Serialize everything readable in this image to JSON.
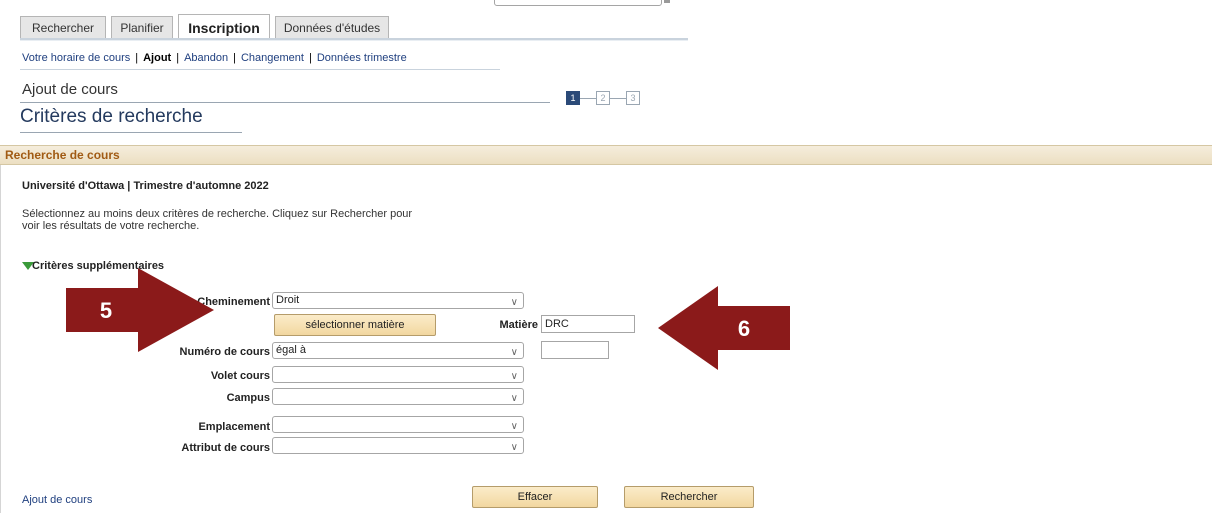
{
  "tabs": [
    "Rechercher",
    "Planifier",
    "Inscription",
    "Données d'études"
  ],
  "subnav": {
    "items": [
      "Votre horaire de cours",
      "Ajout",
      "Abandon",
      "Changement",
      "Données trimestre"
    ],
    "separator": "|"
  },
  "page": {
    "heading": "Ajout de cours",
    "subheading": "Critères de recherche",
    "steps": [
      "1",
      "2",
      "3"
    ]
  },
  "section": {
    "title": "Recherche de cours",
    "institution": "Université d'Ottawa | Trimestre d'automne 2022",
    "instructions_line1": "Sélectionnez au moins deux critères de recherche. Cliquez sur Rechercher pour",
    "instructions_line2": "voir les résultats de votre recherche.",
    "more_criteria": "Critères supplémentaires"
  },
  "form": {
    "cheminement_label": "Cheminement",
    "cheminement_value": "Droit",
    "select_subject_button": "sélectionner matière",
    "matiere_label": "Matière",
    "matiere_value": "DRC",
    "numero_label": "Numéro de cours",
    "numero_value": "égal à",
    "numero_input_value": "",
    "volet_label": "Volet cours",
    "campus_label": "Campus",
    "emplacement_label": "Emplacement",
    "attribut_label": "Attribut de cours"
  },
  "actions": {
    "clear": "Effacer",
    "search": "Rechercher"
  },
  "footer": {
    "link": "Ajout de cours"
  },
  "annotations": {
    "left_number": "5",
    "right_number": "6",
    "color": "#8b1a1a"
  },
  "icons": {
    "dropdown": "chevron-down-icon",
    "expand": "triangle-down-icon"
  }
}
